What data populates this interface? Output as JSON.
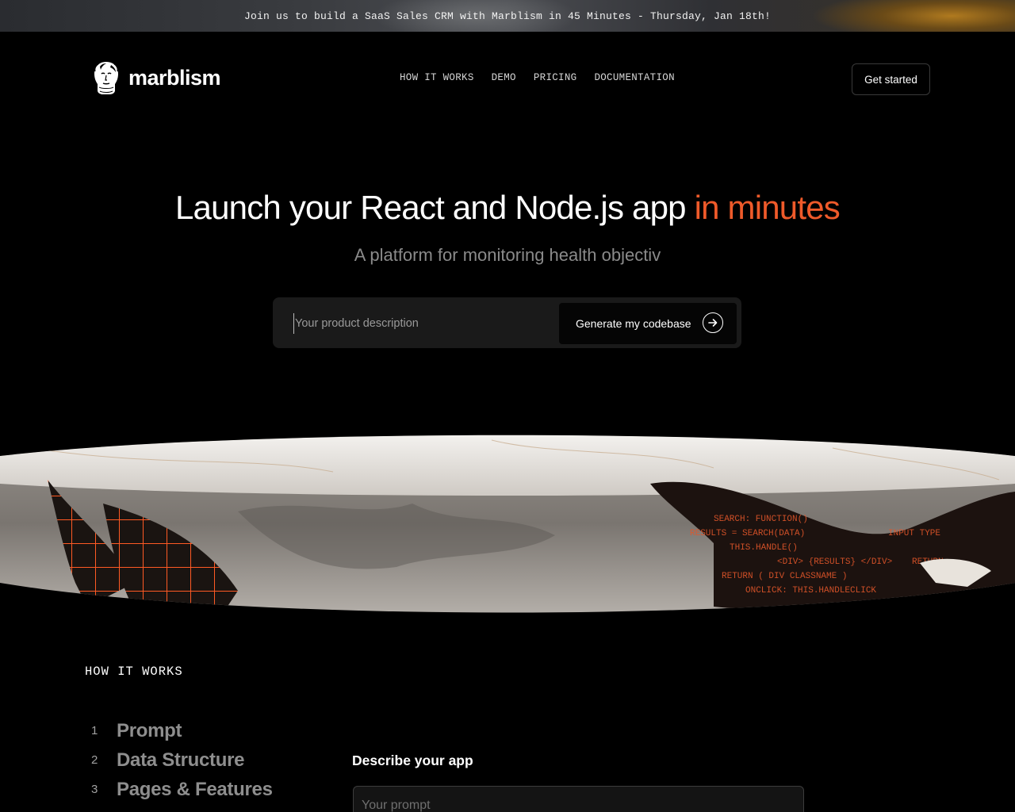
{
  "banner": {
    "text": "Join us to build a SaaS Sales CRM with Marblism in 45 Minutes - Thursday, Jan 18th!"
  },
  "header": {
    "logo_text": "marblism",
    "logo_icon": "marble-bust-icon",
    "nav": [
      {
        "label": "HOW IT WORKS"
      },
      {
        "label": "DEMO"
      },
      {
        "label": "PRICING"
      },
      {
        "label": "DOCUMENTATION"
      }
    ],
    "cta_label": "Get started"
  },
  "hero": {
    "title_main": "Launch your React and Node.js app ",
    "title_accent": "in minutes",
    "subtitle": "A platform for monitoring health objectiv",
    "input_placeholder": "Your product description",
    "button_label": "Generate my codebase",
    "button_icon": "arrow-right-circle-icon"
  },
  "colors": {
    "accent": "#ef5a2a",
    "background": "#000000"
  },
  "how_it_works": {
    "label": "HOW IT WORKS",
    "steps": [
      {
        "num": "1",
        "title": "Prompt"
      },
      {
        "num": "2",
        "title": "Data Structure"
      },
      {
        "num": "3",
        "title": "Pages & Features"
      }
    ],
    "describe_label": "Describe your app",
    "prompt_placeholder": "Your prompt"
  }
}
